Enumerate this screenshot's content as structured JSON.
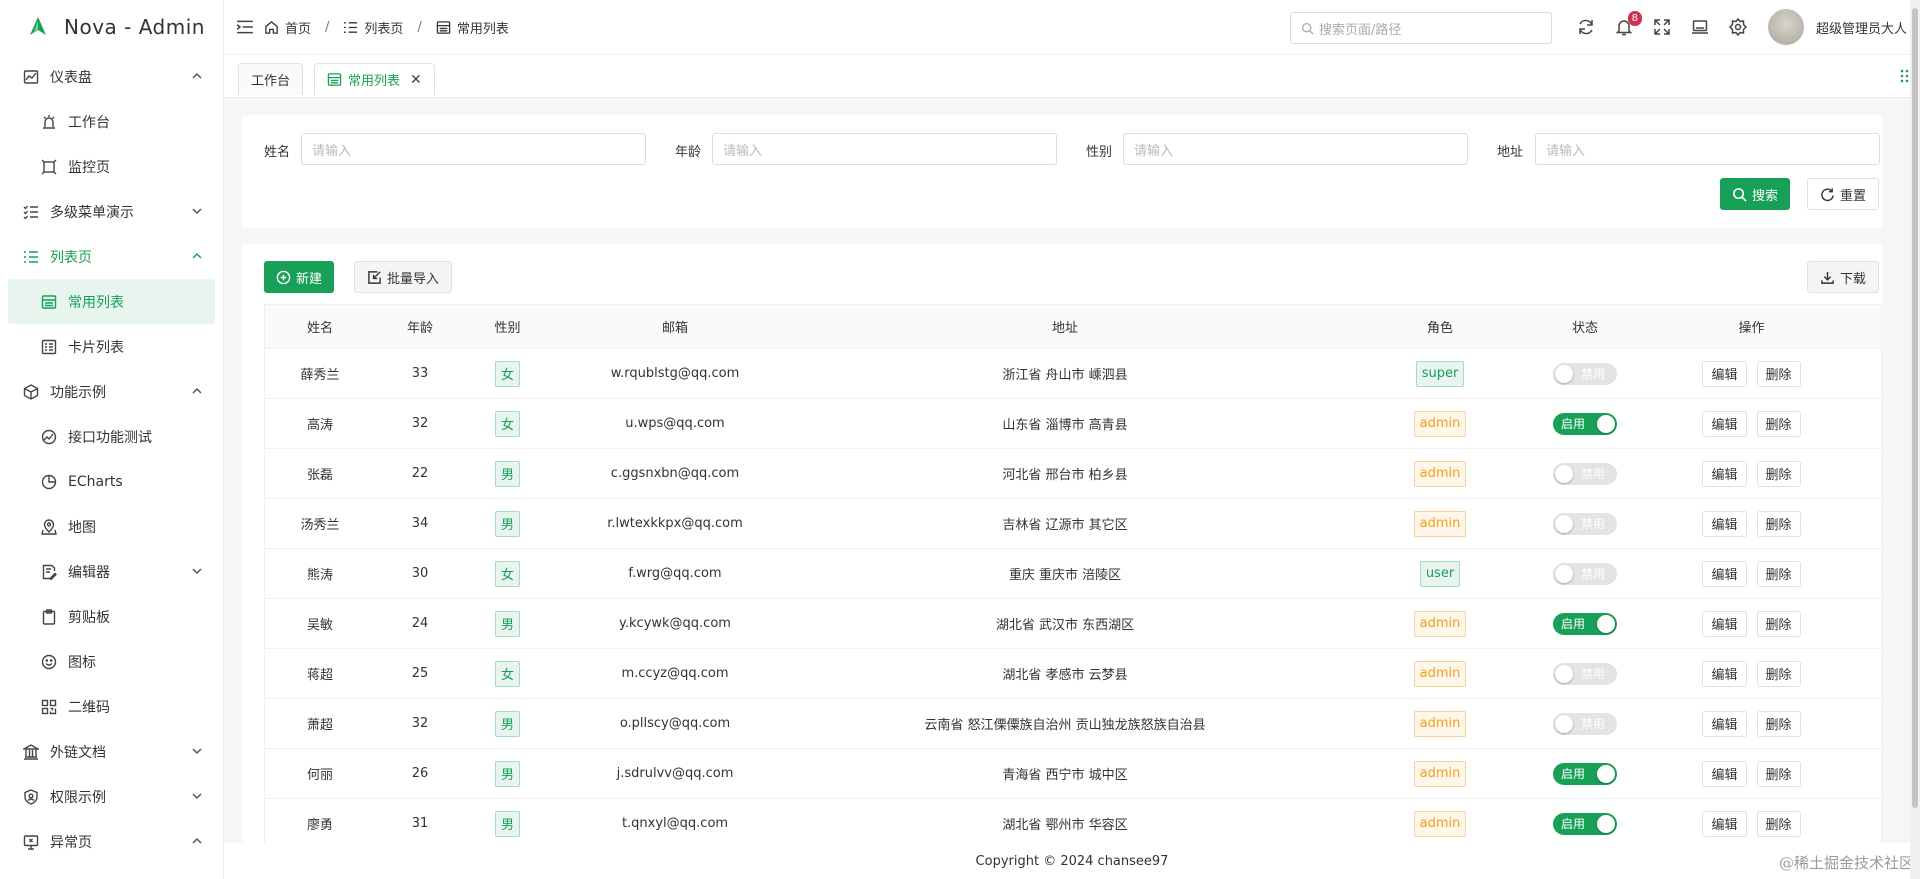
{
  "app": {
    "title": "Nova - Admin"
  },
  "menu": {
    "dashboard": "仪表盘",
    "workbench": "工作台",
    "monitor": "监控页",
    "multilevel": "多级菜单演示",
    "listpage": "列表页",
    "common_list": "常用列表",
    "card_list": "卡片列表",
    "features": "功能示例",
    "api_test": "接口功能测试",
    "echarts": "ECharts",
    "map": "地图",
    "editor": "编辑器",
    "clipboard": "剪贴板",
    "icons": "图标",
    "qrcode": "二维码",
    "external_docs": "外链文档",
    "permission": "权限示例",
    "exception": "异常页"
  },
  "breadcrumb": [
    "首页",
    "列表页",
    "常用列表"
  ],
  "header": {
    "search_placeholder": "搜索页面/路径",
    "notification_count": "8",
    "username": "超级管理员大人"
  },
  "tabs": [
    {
      "label": "工作台"
    },
    {
      "label": "常用列表"
    }
  ],
  "filters": {
    "name_label": "姓名",
    "age_label": "年龄",
    "gender_label": "性别",
    "address_label": "地址",
    "placeholder": "请输入",
    "search_btn": "搜索",
    "reset_btn": "重置"
  },
  "toolbar": {
    "new_btn": "新建",
    "import_btn": "批量导入",
    "download_btn": "下载"
  },
  "table": {
    "columns": [
      "姓名",
      "年龄",
      "性别",
      "邮箱",
      "地址",
      "角色",
      "状态",
      "操作"
    ],
    "edit_label": "编辑",
    "delete_label": "删除",
    "rows": [
      {
        "name": "薛秀兰",
        "age": "33",
        "gender": "女",
        "email": "w.rqublstg@qq.com",
        "address": "浙江省 舟山市 嵊泗县",
        "role": "super",
        "status": "禁用",
        "on": false
      },
      {
        "name": "高涛",
        "age": "32",
        "gender": "女",
        "email": "u.wps@qq.com",
        "address": "山东省 淄博市 高青县",
        "role": "admin",
        "status": "启用",
        "on": true
      },
      {
        "name": "张磊",
        "age": "22",
        "gender": "男",
        "email": "c.ggsnxbn@qq.com",
        "address": "河北省 邢台市 柏乡县",
        "role": "admin",
        "status": "禁用",
        "on": false
      },
      {
        "name": "汤秀兰",
        "age": "34",
        "gender": "男",
        "email": "r.lwtexkkpx@qq.com",
        "address": "吉林省 辽源市 其它区",
        "role": "admin",
        "status": "禁用",
        "on": false
      },
      {
        "name": "熊涛",
        "age": "30",
        "gender": "女",
        "email": "f.wrg@qq.com",
        "address": "重庆 重庆市 涪陵区",
        "role": "user",
        "status": "禁用",
        "on": false
      },
      {
        "name": "吴敏",
        "age": "24",
        "gender": "男",
        "email": "y.kcywk@qq.com",
        "address": "湖北省 武汉市 东西湖区",
        "role": "admin",
        "status": "启用",
        "on": true
      },
      {
        "name": "蒋超",
        "age": "25",
        "gender": "女",
        "email": "m.ccyz@qq.com",
        "address": "湖北省 孝感市 云梦县",
        "role": "admin",
        "status": "禁用",
        "on": false
      },
      {
        "name": "萧超",
        "age": "32",
        "gender": "男",
        "email": "o.pllscy@qq.com",
        "address": "云南省 怒江傈僳族自治州 贡山独龙族怒族自治县",
        "role": "admin",
        "status": "禁用",
        "on": false
      },
      {
        "name": "何丽",
        "age": "26",
        "gender": "男",
        "email": "j.sdrulvv@qq.com",
        "address": "青海省 西宁市 城中区",
        "role": "admin",
        "status": "启用",
        "on": true
      },
      {
        "name": "廖勇",
        "age": "31",
        "gender": "男",
        "email": "t.qnxyl@qq.com",
        "address": "湖北省 鄂州市 华容区",
        "role": "admin",
        "status": "启用",
        "on": true
      }
    ]
  },
  "footer": {
    "copyright": "Copyright © 2024 chansee97"
  },
  "watermark": "@稀土掘金技术社区",
  "colors": {
    "primary": "#18a058",
    "warning": "#f0a020",
    "danger": "#d03050"
  }
}
